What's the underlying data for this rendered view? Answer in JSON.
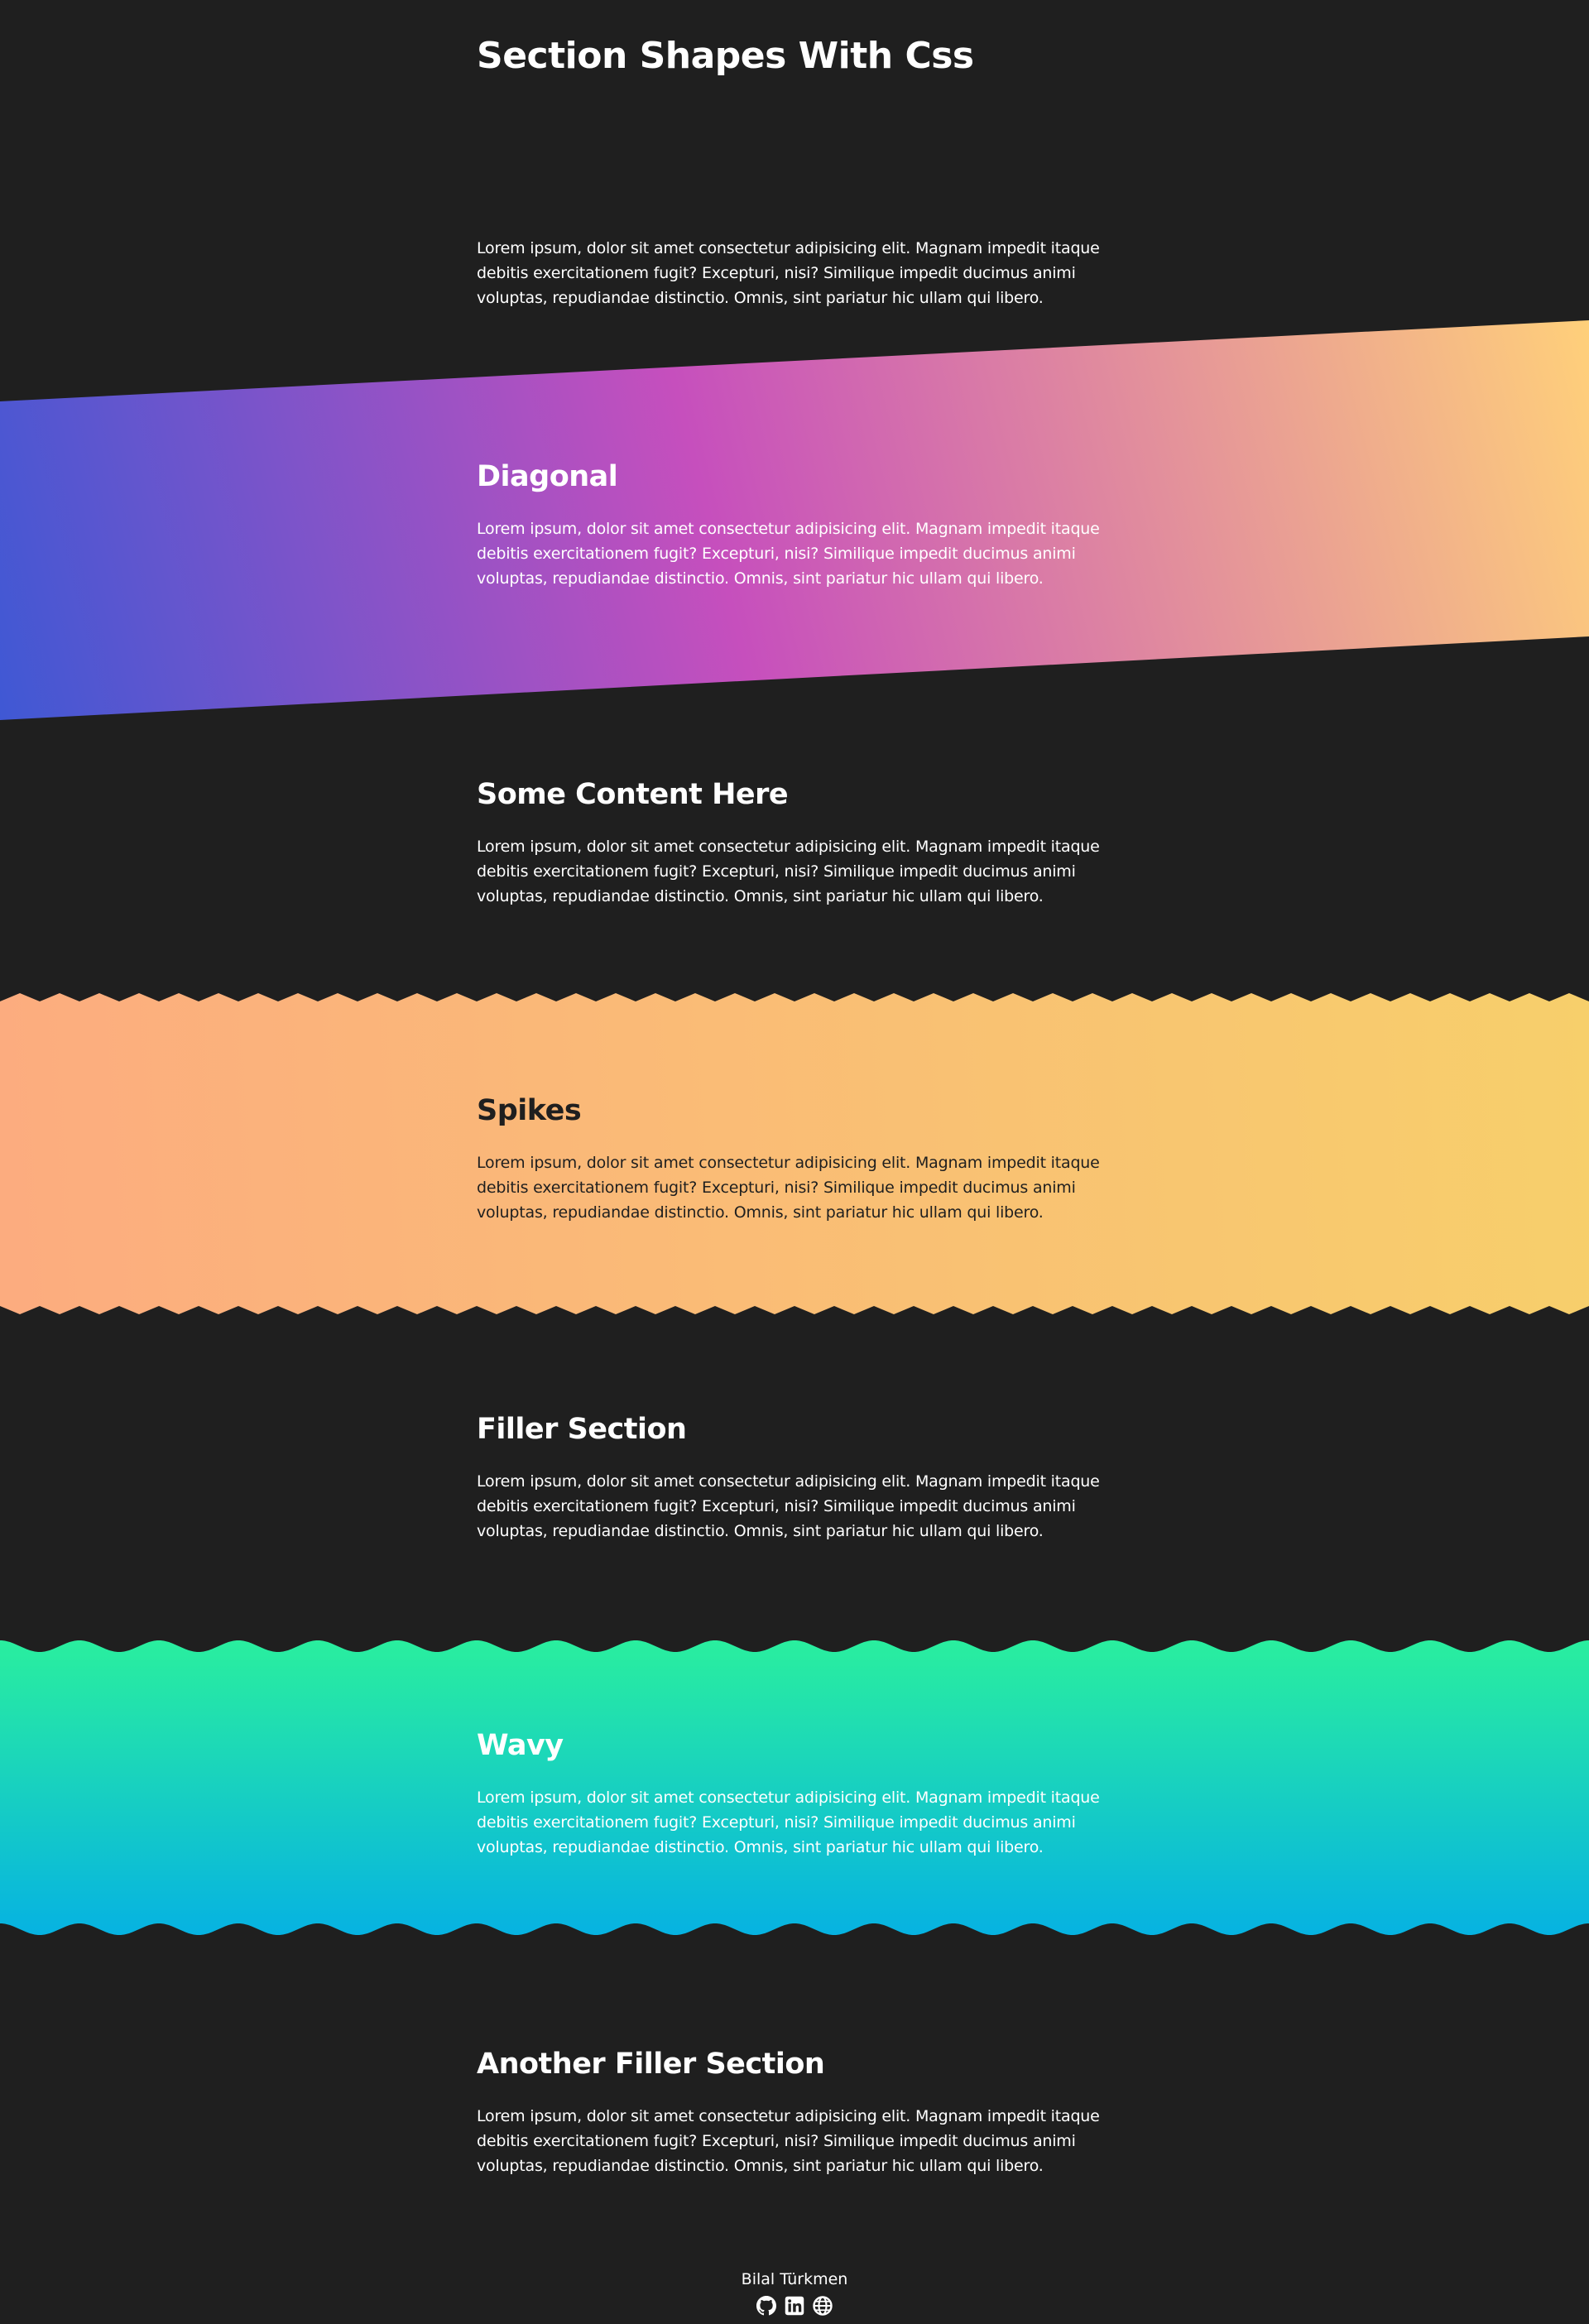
{
  "page": {
    "title": "Section Shapes With Css"
  },
  "intro": {
    "text": "Lorem ipsum, dolor sit amet consectetur adipisicing elit. Magnam impedit itaque debitis exercitationem fugit? Excepturi, nisi? Similique impedit ducimus animi voluptas, repudiandae distinctio. Omnis, sint pariatur hic ullam qui libero."
  },
  "sections": {
    "diagonal": {
      "title": "Diagonal",
      "text": "Lorem ipsum, dolor sit amet consectetur adipisicing elit. Magnam impedit itaque debitis exercitationem fugit? Excepturi, nisi? Similique impedit ducimus animi voluptas, repudiandae distinctio. Omnis, sint pariatur hic ullam qui libero."
    },
    "some_content": {
      "title": "Some Content Here",
      "text": "Lorem ipsum, dolor sit amet consectetur adipisicing elit. Magnam impedit itaque debitis exercitationem fugit? Excepturi, nisi? Similique impedit ducimus animi voluptas, repudiandae distinctio. Omnis, sint pariatur hic ullam qui libero."
    },
    "spikes": {
      "title": "Spikes",
      "text": "Lorem ipsum, dolor sit amet consectetur adipisicing elit. Magnam impedit itaque debitis exercitationem fugit? Excepturi, nisi? Similique impedit ducimus animi voluptas, repudiandae distinctio. Omnis, sint pariatur hic ullam qui libero."
    },
    "filler": {
      "title": "Filler Section",
      "text": "Lorem ipsum, dolor sit amet consectetur adipisicing elit. Magnam impedit itaque debitis exercitationem fugit? Excepturi, nisi? Similique impedit ducimus animi voluptas, repudiandae distinctio. Omnis, sint pariatur hic ullam qui libero."
    },
    "wavy": {
      "title": "Wavy",
      "text": "Lorem ipsum, dolor sit amet consectetur adipisicing elit. Magnam impedit itaque debitis exercitationem fugit? Excepturi, nisi? Similique impedit ducimus animi voluptas, repudiandae distinctio. Omnis, sint pariatur hic ullam qui libero."
    },
    "another_filler": {
      "title": "Another Filler Section",
      "text": "Lorem ipsum, dolor sit amet consectetur adipisicing elit. Magnam impedit itaque debitis exercitationem fugit? Excepturi, nisi? Similique impedit ducimus animi voluptas, repudiandae distinctio. Omnis, sint pariatur hic ullam qui libero."
    }
  },
  "footer": {
    "author": "Bilal Türkmen",
    "icons": [
      "github-icon",
      "linkedin-icon",
      "globe-icon"
    ]
  },
  "colors": {
    "background": "#1f1f1f",
    "diagonal_gradient": [
      "#3f58d4",
      "#c64fbd",
      "#ffd07a"
    ],
    "spikes_gradient": [
      "#fcac7f",
      "#f7cf6b"
    ],
    "wavy_gradient": [
      "#2aef9e",
      "#06b2e2"
    ]
  }
}
